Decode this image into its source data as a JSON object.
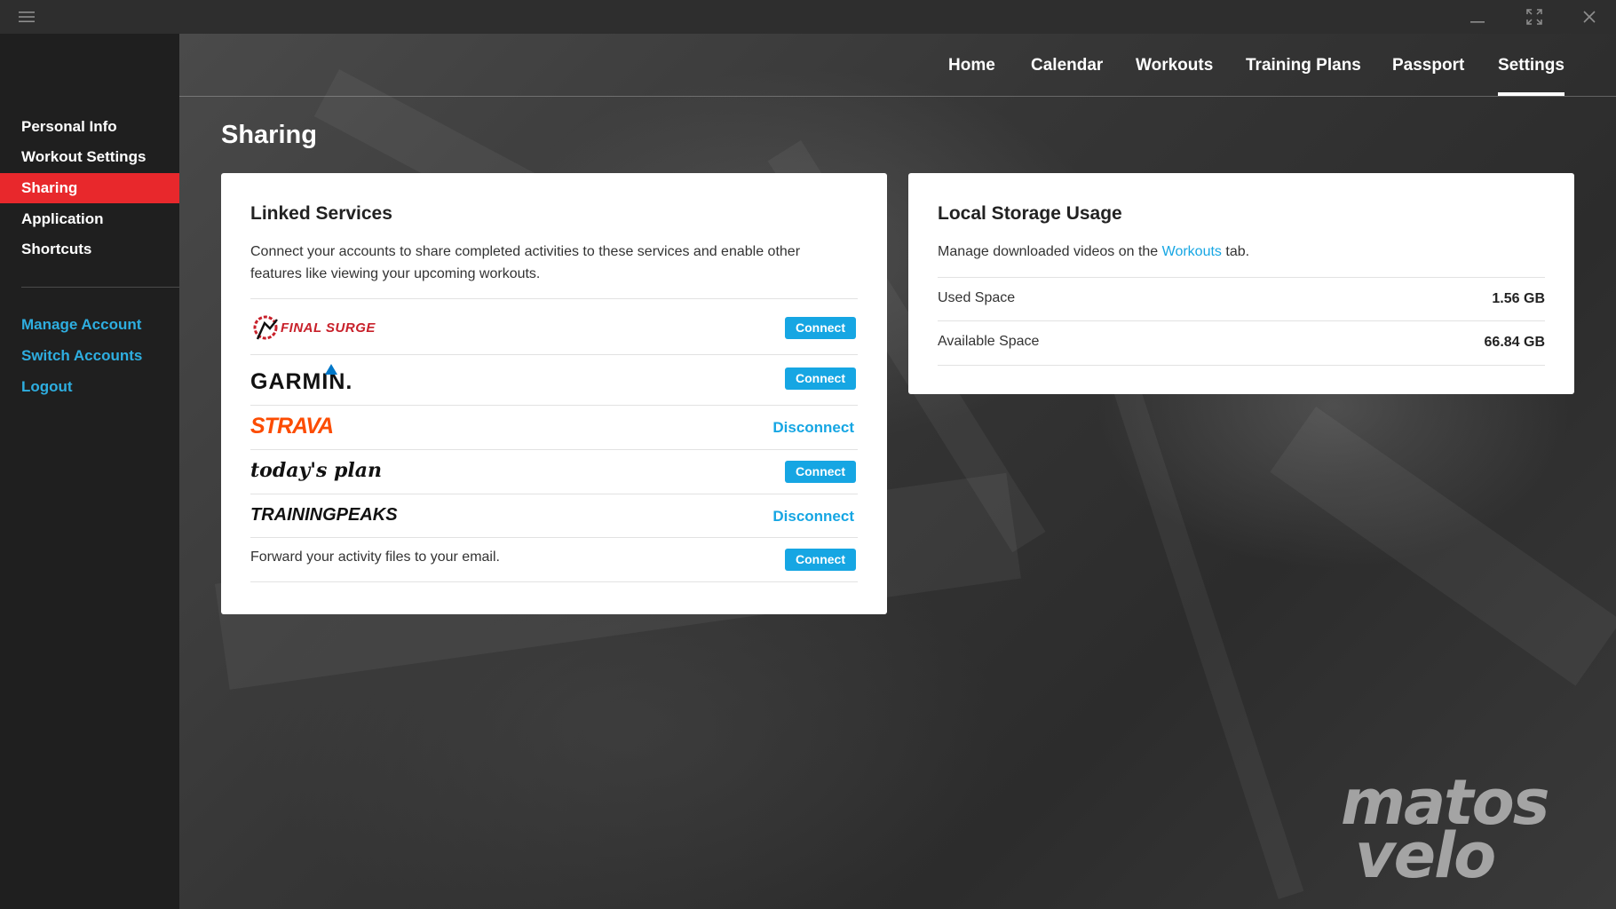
{
  "titlebar": {
    "menu_icon": "hamburger-menu-icon",
    "minimize_icon": "minimize-icon",
    "maximize_icon": "fullscreen-icon",
    "close_icon": "close-icon"
  },
  "sidebar": {
    "items": [
      {
        "label": "Personal Info"
      },
      {
        "label": "Workout Settings"
      },
      {
        "label": "Sharing",
        "active": true
      },
      {
        "label": "Application"
      },
      {
        "label": "Shortcuts"
      }
    ],
    "account_links": [
      {
        "label": "Manage Account"
      },
      {
        "label": "Switch Accounts"
      },
      {
        "label": "Logout"
      }
    ]
  },
  "nav": {
    "tabs": [
      {
        "label": "Home"
      },
      {
        "label": "Calendar"
      },
      {
        "label": "Workouts"
      },
      {
        "label": "Training Plans"
      },
      {
        "label": "Passport"
      },
      {
        "label": "Settings",
        "active": true
      }
    ]
  },
  "page": {
    "title": "Sharing"
  },
  "linked_services": {
    "title": "Linked Services",
    "description": "Connect your accounts to share completed activities to these services and enable other features like viewing your upcoming workouts.",
    "services": [
      {
        "name": "FINAL SURGE",
        "action": "Connect"
      },
      {
        "name": "GARMIN.",
        "action": "Connect"
      },
      {
        "name": "STRAVA",
        "action": "Disconnect"
      },
      {
        "name": "today's plan",
        "action": "Connect"
      },
      {
        "name": "TRAININGPEAKS",
        "action": "Disconnect"
      }
    ],
    "forward": {
      "text": "Forward your activity files to your email.",
      "action": "Connect"
    }
  },
  "storage": {
    "title": "Local Storage Usage",
    "desc_prefix": "Manage downloaded videos on the ",
    "desc_link": "Workouts",
    "desc_suffix": " tab.",
    "rows": [
      {
        "label": "Used Space",
        "value": "1.56 GB"
      },
      {
        "label": "Available Space",
        "value": "66.84 GB"
      }
    ]
  },
  "watermark": {
    "line1": "matos",
    "line2": "velo"
  },
  "colors": {
    "accent_red": "#e8282c",
    "link_blue": "#2eaee0",
    "button_blue": "#16a6e3",
    "strava_orange": "#fc4c02"
  }
}
